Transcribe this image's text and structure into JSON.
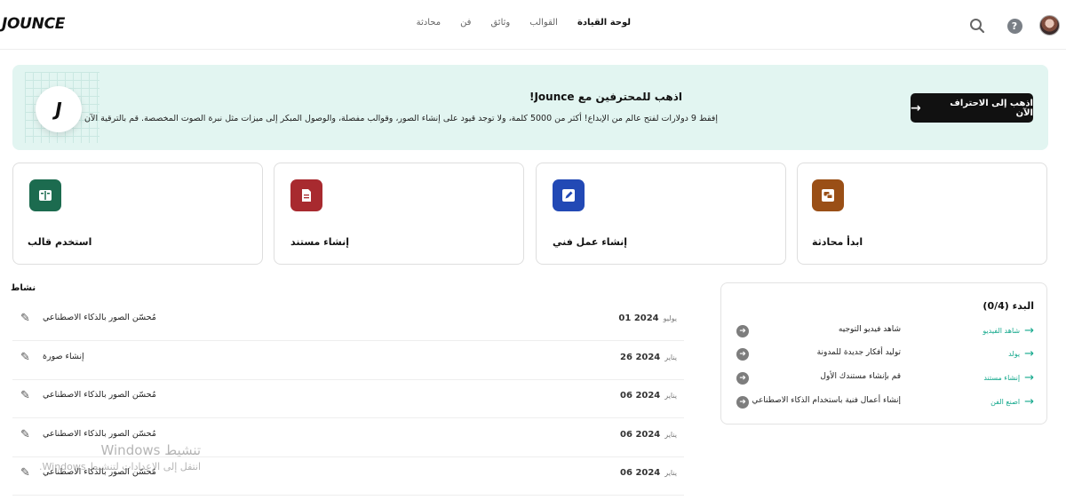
{
  "header": {
    "logo": "JOUNCE",
    "nav": [
      {
        "label": "لوحة القيادة",
        "active": true
      },
      {
        "label": "القوالب",
        "active": false
      },
      {
        "label": "وثائق",
        "active": false
      },
      {
        "label": "فن",
        "active": false
      },
      {
        "label": "محادثة",
        "active": false
      }
    ],
    "icons": [
      "search-icon",
      "help-icon",
      "avatar"
    ],
    "help_glyph": "?"
  },
  "promo": {
    "logo_mark": "J",
    "title": "اذهب للمحترفين مع Jounce!",
    "description": "إفقط 9 دولارات لفتح عالم من الإبداع! أكثر من 5000 كلمة، ولا توجد قيود على إنشاء الصور، وقوالب مفصلة، والوصول المبكر إلى ميزات مثل نبرة الصوت المخصصة. قم بالترقية الآن",
    "cta_label": "اذهب إلى الاحتراف الآن",
    "cta_arrow": "→",
    "bg_color": "#e2f5f1"
  },
  "cards": [
    {
      "label": "استخدم قالب",
      "icon": "book-icon",
      "color": "#1c6b4f"
    },
    {
      "label": "إنشاء مستند",
      "icon": "document-icon",
      "color": "#a82a2f"
    },
    {
      "label": "إنشاء عمل فني",
      "icon": "pencil-icon",
      "color": "#2249b5"
    },
    {
      "label": "ابدأ محادثة",
      "icon": "chat-icon",
      "color": "#9a4f16"
    }
  ],
  "activity": {
    "title": "نشاط",
    "rows": [
      {
        "name": "مُحسّن الصور بالذكاء الاصطناعي",
        "month": "يوليو",
        "date": "2024 01"
      },
      {
        "name": "إنشاء صورة",
        "month": "يناير",
        "date": "2024 26"
      },
      {
        "name": "مُحسّن الصور بالذكاء الاصطناعي",
        "month": "يناير",
        "date": "2024 06"
      },
      {
        "name": "مُحسّن الصور بالذكاء الاصطناعي",
        "month": "يناير",
        "date": "2024 06"
      },
      {
        "name": "مُحسّن الصور بالذكاء الاصطناعي",
        "month": "يناير",
        "date": "2024 06"
      }
    ]
  },
  "getting_started": {
    "title": "البدء (0/4)",
    "items": [
      {
        "task": "شاهد فيديو التوجيه",
        "link": "شاهد الفيديو"
      },
      {
        "task": "توليد أفكار جديدة للمدونة",
        "link": "يولد"
      },
      {
        "task": "قم بإنشاء مستندك الأول",
        "link": "إنشاء مستند"
      },
      {
        "task": "إنشاء أعمال فنية باستخدام الذكاء الاصطناعي",
        "link": "اصنع الفن"
      }
    ]
  },
  "watermark": {
    "line1": "تنشيط Windows",
    "line2": "انتقل إلى الإعدادات لتنشيط Windows."
  },
  "colors": {
    "accent": "#13a88c",
    "dark_button": "#111111"
  }
}
